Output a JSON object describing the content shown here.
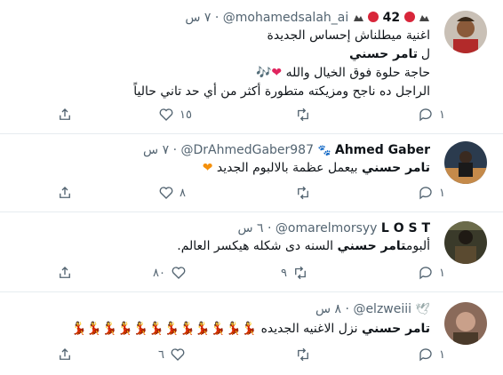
{
  "tweets": [
    {
      "name_prefix": "42",
      "handle": "@mohamedsalah_ai",
      "time": "٧ س",
      "lines": [
        "اغنية ميطلناش إحساس الجديدة",
        "ل",
        "تامر حسني",
        "حاجة حلوة فوق الخيال والله",
        "الراجل ده ناجح ومزيكته متطورة أكثر من أي حد تاني حالياً"
      ],
      "reply_count": "١",
      "retweet_count": "",
      "like_count": "١٥"
    },
    {
      "name": "Ahmed Gaber",
      "handle": "@DrAhmedGaber987",
      "time": "٧ س",
      "bold": "تامر حسني",
      "text": "بيعمل عظمة بالالبوم الجديد",
      "reply_count": "١",
      "retweet_count": "",
      "like_count": "٨"
    },
    {
      "name": "L O S T",
      "handle": "@omarelmorsyy",
      "time": "٦ س",
      "pre": "ألبوم",
      "bold": "تامر حسني",
      "text": "السنه دى شكله هيكسر العالم.",
      "reply_count": "١",
      "retweet_count": "٩",
      "like_count": "٨٠"
    },
    {
      "handle": "@elzweiii",
      "time": "٨ س",
      "bold": "تامر حسني",
      "text": "نزل الاغنيه الجديده",
      "reply_count": "١",
      "retweet_count": "",
      "like_count": "٦"
    }
  ],
  "icons": {
    "reply": "reply-icon",
    "retweet": "retweet-icon",
    "like": "like-icon",
    "share": "share-icon"
  }
}
